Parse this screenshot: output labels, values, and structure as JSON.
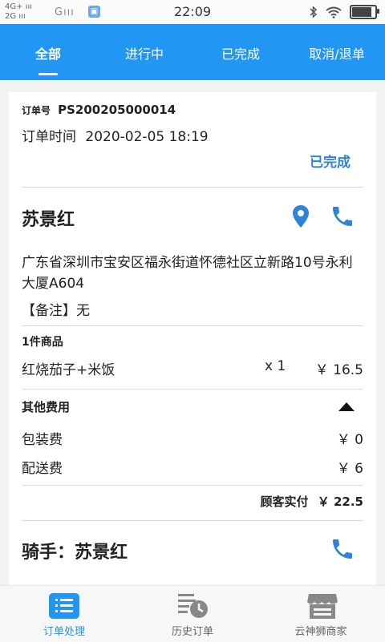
{
  "status_bar": {
    "net_top": "4G+ ııı",
    "net_bottom": "2G ııı",
    "carrier": "Gııı",
    "time": "22:09"
  },
  "tabs": [
    {
      "label": "全部",
      "active": true
    },
    {
      "label": "进行中",
      "active": false
    },
    {
      "label": "已完成",
      "active": false
    },
    {
      "label": "取消/退单",
      "active": false
    }
  ],
  "order": {
    "number_label": "订单号",
    "number": "PS200205000014",
    "time_label": "订单时间",
    "time": "2020-02-05 18:19",
    "status": "已完成",
    "customer_name": "苏景红",
    "address": "广东省深圳市宝安区福永街道怀德社区立新路10号永利大厦A604",
    "remark_label": "【备注】",
    "remark": "无",
    "goods_title": "1件商品",
    "items": [
      {
        "name": "红烧茄子+米饭",
        "qty": "x 1",
        "price": "￥ 16.5"
      }
    ],
    "fees_title": "其他费用",
    "fees": [
      {
        "name": "包装费",
        "amount": "￥ 0"
      },
      {
        "name": "配送费",
        "amount": "￥ 6"
      }
    ],
    "total_label": "顾客实付",
    "total": "￥ 22.5",
    "rider_label": "骑手：",
    "rider_name": "苏景红"
  },
  "bottom_nav": [
    {
      "label": "订单处理",
      "active": true
    },
    {
      "label": "历史订单",
      "active": false
    },
    {
      "label": "云神狮商家",
      "active": false
    }
  ],
  "colors": {
    "primary": "#2196f3",
    "status_blue": "#2f84d6"
  }
}
